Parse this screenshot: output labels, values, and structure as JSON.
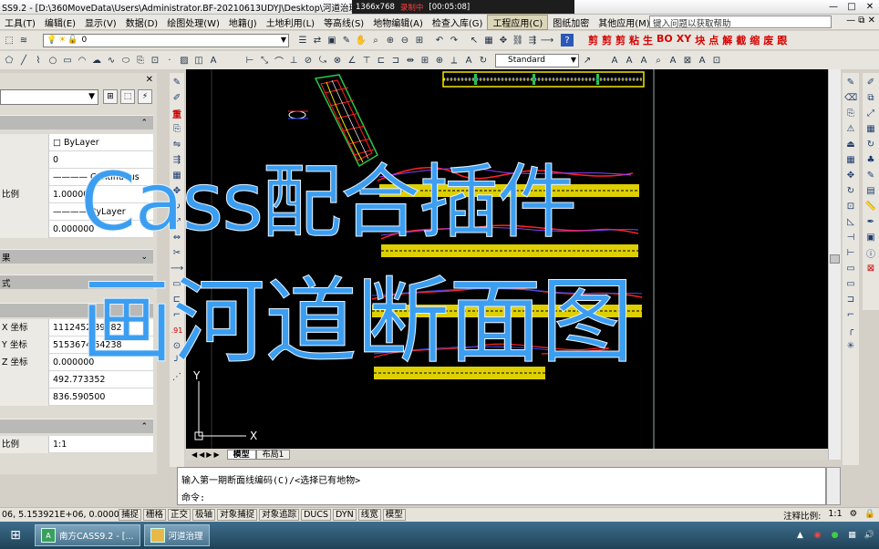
{
  "window": {
    "title": "SS9.2 - [D:\\360MoveData\\Users\\Administrator.BF-20210613UDYJ\\Desktop\\河道治理\\",
    "controls": [
      "—",
      "□",
      "✕"
    ]
  },
  "recorder": {
    "resolution": "1366x768",
    "status": "录制中",
    "time": "[00:05:08]"
  },
  "menu": {
    "items": [
      "工具(T)",
      "编辑(E)",
      "显示(V)",
      "数据(D)",
      "绘图处理(W)",
      "地籍(J)",
      "土地利用(L)",
      "等高线(S)",
      "地物编辑(A)",
      "检查入库(G)",
      "工程应用(C)",
      "图纸加密",
      "其他应用(M)"
    ],
    "active_index": 10,
    "help_placeholder": "键入问题以获取帮助"
  },
  "toolbar": {
    "layer_value": "0",
    "text_style": "Standard",
    "red_tools": [
      "剪",
      "剪",
      "剪",
      "粘",
      "生",
      "BO",
      "XY",
      "块",
      "点",
      "解",
      "截",
      "缩",
      "废",
      "跟"
    ]
  },
  "properties": {
    "sections": {
      "general": "",
      "view": "果",
      "misc": "式",
      "other": ""
    },
    "rows": [
      {
        "label": "",
        "value": "□ ByLayer"
      },
      {
        "label": "",
        "value": "0"
      },
      {
        "label": "",
        "value": "———— Continuous"
      },
      {
        "label": "比例",
        "value": "1.000000"
      },
      {
        "label": "",
        "value": "———— ByLayer"
      },
      {
        "label": "",
        "value": "0.000000"
      }
    ],
    "geometry_rows": [
      {
        "label": "X 坐标",
        "value": "1112452.39182"
      },
      {
        "label": "Y 坐标",
        "value": "5153674.54238"
      },
      {
        "label": "Z 坐标",
        "value": "0.000000"
      },
      {
        "label": "",
        "value": "492.773352"
      },
      {
        "label": "",
        "value": "836.590500"
      }
    ],
    "scale_row": {
      "label": "比例",
      "value": "1:1"
    }
  },
  "layout_tabs": [
    "模型",
    "布局1"
  ],
  "command": {
    "line1": "输入第一期断面线编码(C)/<选择已有地物>",
    "line2": "命令:"
  },
  "status": {
    "coords": "06, 5.153921E+06, 0.000000",
    "toggles": [
      "捕捉",
      "栅格",
      "正交",
      "极轴",
      "对象捕捉",
      "对象追踪",
      "DUCS",
      "DYN",
      "线宽",
      "模型"
    ],
    "annotation_scale_label": "注释比例:",
    "annotation_scale": "1:1"
  },
  "taskbar": {
    "buttons": [
      "南方CASS9.2 - [...",
      "河道治理"
    ]
  },
  "overlay": {
    "line1": "Cass配合插件",
    "line2": "画河道断面图"
  },
  "colors": {
    "overlay_text": "#3c9ef0",
    "canvas_bg": "#000000",
    "section_yellow": "#f6e600"
  }
}
